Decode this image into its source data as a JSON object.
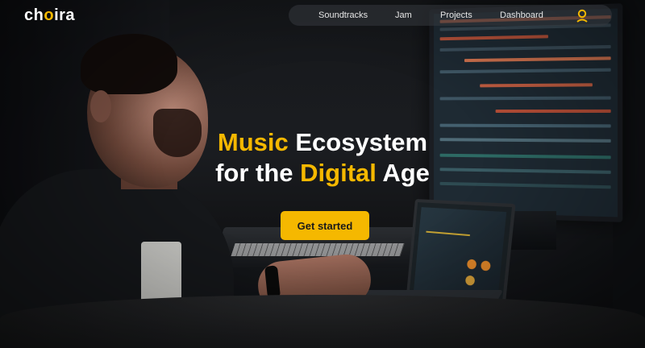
{
  "brand": {
    "logo_pre": "ch",
    "logo_o": "o",
    "logo_post": "ira",
    "accent_color": "#f5b800"
  },
  "nav": {
    "items": [
      {
        "label": "Soundtracks"
      },
      {
        "label": "Jam"
      },
      {
        "label": "Projects"
      },
      {
        "label": "Dashboard"
      }
    ],
    "user_icon": "user-icon"
  },
  "hero": {
    "headline_line1_accent": "Music",
    "headline_line1_rest": " Ecosystem",
    "headline_line2_pre": "for the ",
    "headline_line2_accent": "Digital",
    "headline_line2_post": " Age",
    "cta_label": "Get started",
    "background_image": "producer-at-daw-studio"
  }
}
